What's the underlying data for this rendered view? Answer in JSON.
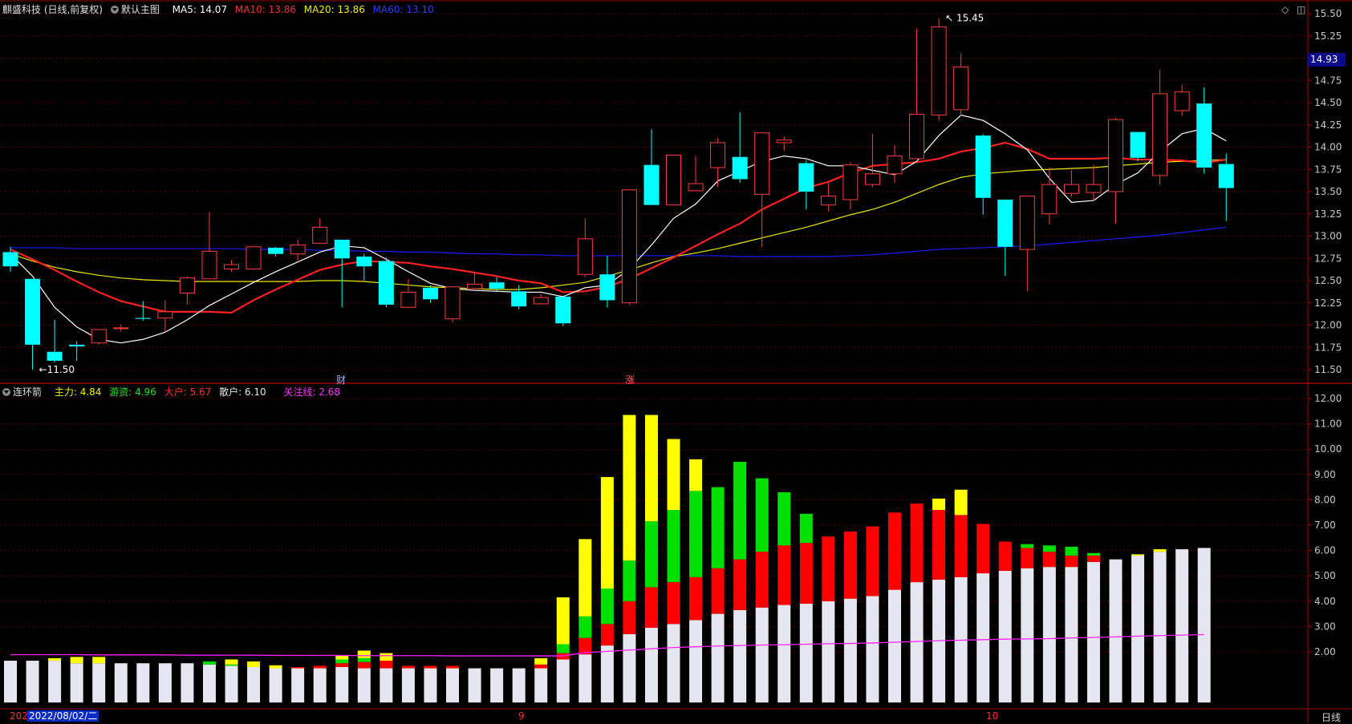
{
  "header": {
    "stock_title": "麒盛科技 (日线,前复权)",
    "main_chart_name": "默认主图",
    "ma5": "MA5: 14.07",
    "ma10": "MA10: 13.86",
    "ma20": "MA20: 13.86",
    "ma60": "MA60: 13.10"
  },
  "sub_header": {
    "indicator_name": "连环箭",
    "zhuli": "主力: 4.84",
    "youzi": "游资: 4.96",
    "dahu": "大户: 5.67",
    "sanhu": "散户: 6.10",
    "guanzhu": "关注线: 2.68"
  },
  "price_badge": "14.93",
  "markers": {
    "cai": "财",
    "zhang": "涨"
  },
  "bottom_bar": {
    "year_fragment": "202",
    "cursor_date": "2022/08/02/二",
    "month_sep": "9",
    "month_oct": "10",
    "period": "日线"
  },
  "colors": {
    "up": "#ff3c3c",
    "down": "#00ffff",
    "ma5": "#ffffff",
    "ma10": "#ff2020",
    "ma20": "#e8e800",
    "ma60": "#1a1aff",
    "white_bar": "#e6e6f0",
    "red_bar": "#ff0000",
    "green_bar": "#00e000",
    "yellow_bar": "#ffff00",
    "line": "#ff20ff"
  },
  "chart_data": [
    {
      "type": "candlestick",
      "title": "麒盛科技 (日线,前复权)",
      "ylim": [
        11.4,
        15.6
      ],
      "yticks": [
        "15.50",
        "15.25",
        "15.00",
        "14.75",
        "14.50",
        "14.25",
        "14.00",
        "13.75",
        "13.50",
        "13.25",
        "13.00",
        "12.75",
        "12.50",
        "12.25",
        "12.00",
        "11.75",
        "11.50"
      ],
      "annotations": {
        "high": "15.45",
        "low": "11.50"
      },
      "candles": [
        [
          12.82,
          12.66,
          12.88,
          12.6
        ],
        [
          12.52,
          11.78,
          12.52,
          11.5
        ],
        [
          11.7,
          11.6,
          12.06,
          11.58
        ],
        [
          11.78,
          11.76,
          11.82,
          11.6
        ],
        [
          11.8,
          11.95,
          11.95,
          11.78
        ],
        [
          11.96,
          11.97,
          12.0,
          11.93
        ],
        [
          12.08,
          12.07,
          12.27,
          12.05
        ],
        [
          12.08,
          12.15,
          12.28,
          11.93
        ],
        [
          12.36,
          12.53,
          12.55,
          12.23
        ],
        [
          12.52,
          12.83,
          13.27,
          12.52
        ],
        [
          12.63,
          12.68,
          12.73,
          12.6
        ],
        [
          12.63,
          12.88,
          12.88,
          12.62
        ],
        [
          12.87,
          12.8,
          12.88,
          12.77
        ],
        [
          12.8,
          12.9,
          12.96,
          12.73
        ],
        [
          12.92,
          13.1,
          13.2,
          12.94
        ],
        [
          12.96,
          12.75,
          12.96,
          12.2
        ],
        [
          12.77,
          12.66,
          12.8,
          12.5
        ],
        [
          12.72,
          12.23,
          12.76,
          12.2
        ],
        [
          12.2,
          12.37,
          12.52,
          12.2
        ],
        [
          12.42,
          12.29,
          12.45,
          12.25
        ],
        [
          12.07,
          12.43,
          12.43,
          12.03
        ],
        [
          12.41,
          12.46,
          12.6,
          12.4
        ],
        [
          12.48,
          12.41,
          12.54,
          12.38
        ],
        [
          12.38,
          12.21,
          12.45,
          12.18
        ],
        [
          12.24,
          12.31,
          12.35,
          12.23
        ],
        [
          12.32,
          12.02,
          12.33,
          11.99
        ],
        [
          12.57,
          12.97,
          13.2,
          12.54
        ],
        [
          12.57,
          12.28,
          12.78,
          12.2
        ],
        [
          12.25,
          13.52,
          13.52,
          12.23
        ],
        [
          13.8,
          13.35,
          14.2,
          13.35
        ],
        [
          13.35,
          13.91,
          13.91,
          13.4
        ],
        [
          13.51,
          13.59,
          13.9,
          13.51
        ],
        [
          13.77,
          14.05,
          14.1,
          13.55
        ],
        [
          13.89,
          13.64,
          14.39,
          13.6
        ],
        [
          13.47,
          14.16,
          14.16,
          12.88
        ],
        [
          14.05,
          14.08,
          14.12,
          13.96
        ],
        [
          13.82,
          13.5,
          13.85,
          13.3
        ],
        [
          13.35,
          13.45,
          13.6,
          13.28
        ],
        [
          13.41,
          13.8,
          13.83,
          13.3
        ],
        [
          13.58,
          13.7,
          14.15,
          13.55
        ],
        [
          13.7,
          13.9,
          14.02,
          13.6
        ],
        [
          13.87,
          14.37,
          15.33,
          13.87
        ],
        [
          14.36,
          15.35,
          15.45,
          14.3
        ],
        [
          14.42,
          14.9,
          15.05,
          14.35
        ],
        [
          14.13,
          13.43,
          14.15,
          13.24
        ],
        [
          13.41,
          12.88,
          13.41,
          12.55
        ],
        [
          12.85,
          13.45,
          13.45,
          12.38
        ],
        [
          13.25,
          13.58,
          13.77,
          13.13
        ],
        [
          13.48,
          13.58,
          13.74,
          13.44
        ],
        [
          13.49,
          13.58,
          13.8,
          13.4
        ],
        [
          13.5,
          14.31,
          14.33,
          13.14
        ],
        [
          14.17,
          13.88,
          14.17,
          13.84
        ],
        [
          13.68,
          14.6,
          14.87,
          13.58
        ],
        [
          14.41,
          14.62,
          14.7,
          14.35
        ],
        [
          14.49,
          13.77,
          14.67,
          13.7
        ],
        [
          13.81,
          13.54,
          13.93,
          13.17
        ]
      ],
      "ma5": [
        12.8,
        12.55,
        12.2,
        11.98,
        11.84,
        11.8,
        11.84,
        11.92,
        12.06,
        12.22,
        12.35,
        12.48,
        12.6,
        12.71,
        12.82,
        12.89,
        12.87,
        12.74,
        12.6,
        12.47,
        12.41,
        12.39,
        12.38,
        12.37,
        12.37,
        12.32,
        12.42,
        12.45,
        12.63,
        12.9,
        13.2,
        13.36,
        13.62,
        13.73,
        13.84,
        13.9,
        13.87,
        13.79,
        13.79,
        13.74,
        13.69,
        13.84,
        14.13,
        14.36,
        14.3,
        14.15,
        13.97,
        13.65,
        13.38,
        13.4,
        13.58,
        13.71,
        13.95,
        14.15,
        14.21,
        14.07
      ],
      "ma10": [
        12.85,
        12.74,
        12.62,
        12.49,
        12.37,
        12.27,
        12.21,
        12.15,
        12.15,
        12.15,
        12.14,
        12.28,
        12.4,
        12.51,
        12.62,
        12.68,
        12.72,
        12.71,
        12.7,
        12.66,
        12.63,
        12.59,
        12.55,
        12.5,
        12.47,
        12.37,
        12.38,
        12.43,
        12.52,
        12.64,
        12.76,
        12.89,
        13.02,
        13.14,
        13.3,
        13.42,
        13.54,
        13.61,
        13.71,
        13.79,
        13.81,
        13.83,
        13.87,
        13.95,
        13.99,
        14.05,
        13.98,
        13.87,
        13.87,
        13.87,
        13.88,
        13.86,
        13.86,
        13.85,
        13.82,
        13.86
      ],
      "ma20": [
        12.8,
        12.72,
        12.65,
        12.6,
        12.56,
        12.53,
        12.51,
        12.5,
        12.49,
        12.49,
        12.49,
        12.49,
        12.49,
        12.49,
        12.5,
        12.5,
        12.49,
        12.47,
        12.45,
        12.43,
        12.42,
        12.41,
        12.4,
        12.4,
        12.42,
        12.45,
        12.48,
        12.55,
        12.62,
        12.7,
        12.77,
        12.81,
        12.86,
        12.92,
        12.98,
        13.04,
        13.1,
        13.17,
        13.24,
        13.3,
        13.38,
        13.48,
        13.58,
        13.66,
        13.7,
        13.72,
        13.74,
        13.75,
        13.76,
        13.77,
        13.79,
        13.81,
        13.83,
        13.84,
        13.85,
        13.86
      ],
      "ma60": [
        12.87,
        12.87,
        12.87,
        12.86,
        12.86,
        12.86,
        12.86,
        12.86,
        12.86,
        12.86,
        12.86,
        12.85,
        12.85,
        12.85,
        12.84,
        12.84,
        12.83,
        12.83,
        12.82,
        12.82,
        12.81,
        12.8,
        12.8,
        12.79,
        12.79,
        12.78,
        12.78,
        12.78,
        12.78,
        12.78,
        12.78,
        12.78,
        12.78,
        12.77,
        12.77,
        12.77,
        12.77,
        12.77,
        12.78,
        12.79,
        12.81,
        12.83,
        12.85,
        12.86,
        12.87,
        12.88,
        12.89,
        12.91,
        12.93,
        12.95,
        12.97,
        12.99,
        13.01,
        13.04,
        13.07,
        13.1
      ]
    },
    {
      "type": "bar",
      "title": "连环箭",
      "ylim": [
        0.0,
        12.4
      ],
      "yticks": [
        "12.00",
        "11.00",
        "10.00",
        "9.00",
        "8.00",
        "7.00",
        "6.00",
        "5.00",
        "4.00",
        "3.00",
        "2.00"
      ],
      "series_names": [
        "散户",
        "大户",
        "游资",
        "主力",
        "关注线"
      ],
      "stacked": [
        [
          1.65,
          0,
          0,
          0
        ],
        [
          1.65,
          0,
          0,
          0
        ],
        [
          1.65,
          0,
          0,
          0.1
        ],
        [
          1.55,
          0,
          0,
          0.25
        ],
        [
          1.55,
          0,
          0,
          0.25
        ],
        [
          1.55,
          0,
          0,
          0
        ],
        [
          1.55,
          0,
          0,
          0
        ],
        [
          1.55,
          0,
          0,
          0
        ],
        [
          1.55,
          0,
          0,
          0
        ],
        [
          1.5,
          0,
          0.12,
          0
        ],
        [
          1.45,
          0,
          0.05,
          0.2
        ],
        [
          1.4,
          0,
          0,
          0.22
        ],
        [
          1.35,
          0,
          0,
          0.12
        ],
        [
          1.35,
          0.05,
          0,
          0
        ],
        [
          1.35,
          0.1,
          0,
          0
        ],
        [
          1.4,
          0.15,
          0.15,
          0.15
        ],
        [
          1.35,
          0.25,
          0.15,
          0.3
        ],
        [
          1.35,
          0.3,
          0,
          0.3
        ],
        [
          1.35,
          0.1,
          0,
          0
        ],
        [
          1.35,
          0.1,
          0,
          0
        ],
        [
          1.35,
          0.1,
          0,
          0
        ],
        [
          1.35,
          0,
          0,
          0
        ],
        [
          1.35,
          0,
          0,
          0
        ],
        [
          1.35,
          0,
          0,
          0
        ],
        [
          1.35,
          0.15,
          0,
          0.25
        ],
        [
          1.7,
          0.25,
          0.35,
          1.85
        ],
        [
          1.9,
          0.65,
          0.85,
          3.05
        ],
        [
          2.25,
          0.85,
          1.4,
          4.4
        ],
        [
          2.7,
          1.3,
          1.6,
          5.75
        ],
        [
          2.95,
          1.6,
          2.6,
          4.2
        ],
        [
          3.1,
          1.65,
          2.85,
          2.8
        ],
        [
          3.25,
          1.7,
          3.4,
          1.25
        ],
        [
          3.5,
          1.8,
          3.2,
          0
        ],
        [
          3.65,
          2.0,
          3.85,
          0
        ],
        [
          3.75,
          2.2,
          2.9,
          0
        ],
        [
          3.85,
          2.35,
          2.1,
          0
        ],
        [
          3.9,
          2.4,
          1.15,
          0
        ],
        [
          4.0,
          2.55,
          0,
          0
        ],
        [
          4.1,
          2.65,
          0,
          0
        ],
        [
          4.2,
          2.75,
          0,
          0
        ],
        [
          4.45,
          3.05,
          0,
          0
        ],
        [
          4.75,
          3.1,
          0,
          0
        ],
        [
          4.85,
          2.75,
          0,
          0.45
        ],
        [
          4.95,
          2.45,
          0,
          1.0
        ],
        [
          5.1,
          1.95,
          0,
          0
        ],
        [
          5.2,
          1.15,
          0,
          0
        ],
        [
          5.3,
          0.8,
          0.15,
          0
        ],
        [
          5.35,
          0.6,
          0.25,
          0
        ],
        [
          5.35,
          0.45,
          0.35,
          0
        ],
        [
          5.55,
          0.25,
          0.1,
          0
        ],
        [
          5.65,
          0,
          0,
          0
        ],
        [
          5.8,
          0,
          0,
          0.05
        ],
        [
          5.95,
          0,
          0,
          0.1
        ],
        [
          6.05,
          0,
          0,
          0
        ],
        [
          6.1,
          0,
          0,
          0
        ]
      ],
      "guanzhu_line": [
        1.89,
        1.89,
        1.89,
        1.89,
        1.88,
        1.88,
        1.88,
        1.88,
        1.87,
        1.87,
        1.87,
        1.87,
        1.86,
        1.86,
        1.86,
        1.86,
        1.85,
        1.85,
        1.85,
        1.85,
        1.84,
        1.84,
        1.84,
        1.84,
        1.84,
        1.84,
        1.97,
        2.02,
        2.07,
        2.12,
        2.17,
        2.2,
        2.23,
        2.25,
        2.27,
        2.28,
        2.3,
        2.32,
        2.33,
        2.35,
        2.38,
        2.41,
        2.44,
        2.46,
        2.48,
        2.5,
        2.51,
        2.52,
        2.55,
        2.57,
        2.59,
        2.62,
        2.64,
        2.66,
        2.68
      ]
    }
  ]
}
